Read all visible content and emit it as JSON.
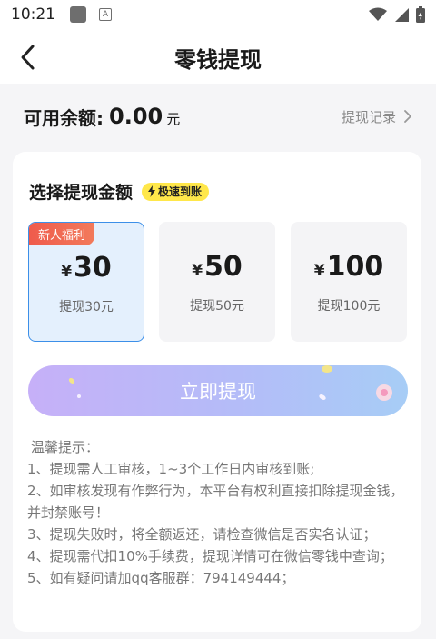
{
  "status_bar": {
    "time": "10:21",
    "icon_a_letter": "A"
  },
  "header": {
    "title": "零钱提现"
  },
  "balance": {
    "label": "可用余额:",
    "value": "0.00",
    "unit": "元",
    "records_link": "提现记录"
  },
  "card": {
    "section_title": "选择提现金额",
    "fast_badge": "极速到账",
    "newbie_tag": "新人福利",
    "currency_symbol": "¥",
    "options": [
      {
        "amount": "30",
        "desc": "提现30元",
        "selected": true
      },
      {
        "amount": "50",
        "desc": "提现50元",
        "selected": false
      },
      {
        "amount": "100",
        "desc": "提现100元",
        "selected": false
      }
    ],
    "withdraw_button": "立即提现",
    "tips": [
      "温馨提示：",
      "1、提现需人工审核，1~3个工作日内审核到账;",
      "2、如审核发现有作弊行为，本平台有权利直接扣除提现金钱，并封禁账号！",
      "3、提现失败时，将全额返还，请检查微信是否实名认证；",
      "4、提现需代扣10%手续费，提现详情可在微信零钱中查询；",
      "5、如有疑问请加qq客服群：794149444；"
    ]
  },
  "colors": {
    "selected_border": "#3c8fe8",
    "selected_bg": "#e4f0fd",
    "badge_yellow": "#ffe74a",
    "newbie_red": "#ef5b4c"
  }
}
